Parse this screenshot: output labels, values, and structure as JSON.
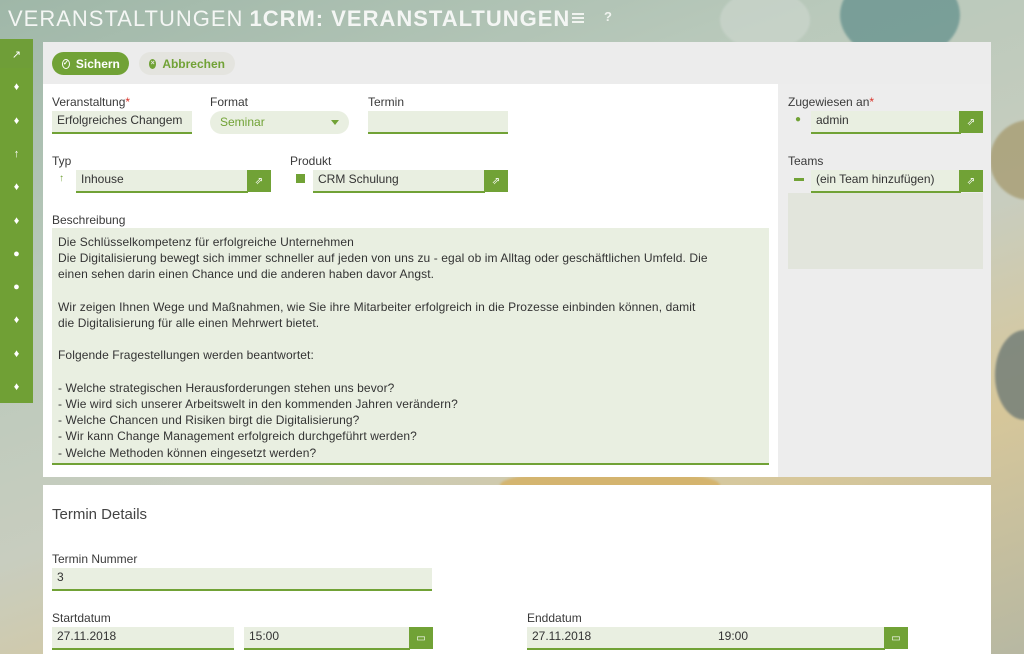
{
  "header": {
    "title_light": "VERANSTALTUNGEN",
    "title_bold": "1CRM: VERANSTALTUNGEN",
    "help_label": "?"
  },
  "sidebar": {
    "items": [
      {
        "icon": "trend-icon",
        "glyph": "↗"
      },
      {
        "icon": "bulb-icon",
        "glyph": "♦"
      },
      {
        "icon": "bulb-icon",
        "glyph": "♦"
      },
      {
        "icon": "pin-icon",
        "glyph": "↑"
      },
      {
        "icon": "bulb-icon",
        "glyph": "♦"
      },
      {
        "icon": "bulb-icon",
        "glyph": "♦"
      },
      {
        "icon": "person-icon",
        "glyph": "●"
      },
      {
        "icon": "person-icon",
        "glyph": "●"
      },
      {
        "icon": "bulb-icon",
        "glyph": "♦"
      },
      {
        "icon": "bulb-icon",
        "glyph": "♦"
      },
      {
        "icon": "bulb-icon",
        "glyph": "♦"
      }
    ]
  },
  "toolbar": {
    "save_label": "Sichern",
    "cancel_label": "Abbrechen"
  },
  "form": {
    "event_label": "Veranstaltung",
    "event_value": "Erfolgreiches Changem",
    "format_label": "Format",
    "format_value": "Seminar",
    "termin_label": "Termin",
    "termin_value": "",
    "type_label": "Typ",
    "type_value": "Inhouse",
    "product_label": "Produkt",
    "product_value": "CRM Schulung",
    "description_label": "Beschreibung",
    "description_lines": [
      "Die Schlüsselkompetenz für erfolgreiche Unternehmen",
      "Die Digitalisierung bewegt sich immer schneller auf jeden von uns zu - egal ob im Alltag oder geschäftlichen Umfeld. Die",
      "einen sehen darin einen Chance und die anderen haben davor Angst.",
      "",
      "Wir zeigen Ihnen Wege und Maßnahmen, wie Sie ihre Mitarbeiter erfolgreich in die Prozesse einbinden können, damit",
      "die Digitalisierung für alle einen Mehrwert bietet.",
      "",
      "Folgende Fragestellungen werden beantwortet:",
      "",
      "- Welche strategischen Herausforderungen stehen uns bevor?",
      "- Wie wird sich unserer Arbeitswelt in den kommenden Jahren verändern?",
      "- Welche Chancen und Risiken birgt die Digitalisierung?",
      "- Wir kann Change Management erfolgreich durchgeführt werden?",
      "- Welche Methoden können eingesetzt werden?"
    ]
  },
  "side": {
    "assigned_label": "Zugewiesen an",
    "assigned_value": "admin",
    "teams_label": "Teams",
    "teams_placeholder": "(ein Team hinzufügen)"
  },
  "details": {
    "title": "Termin Details",
    "number_label": "Termin Nummer",
    "number_value": "3",
    "start_label": "Startdatum",
    "start_date": "27.11.2018",
    "start_time": "15:00",
    "end_label": "Enddatum",
    "end_date": "27.11.2018",
    "end_time": "19:00"
  },
  "colors": {
    "accent": "#71a236",
    "field_bg": "#e9efe1",
    "required": "#d9342b"
  }
}
